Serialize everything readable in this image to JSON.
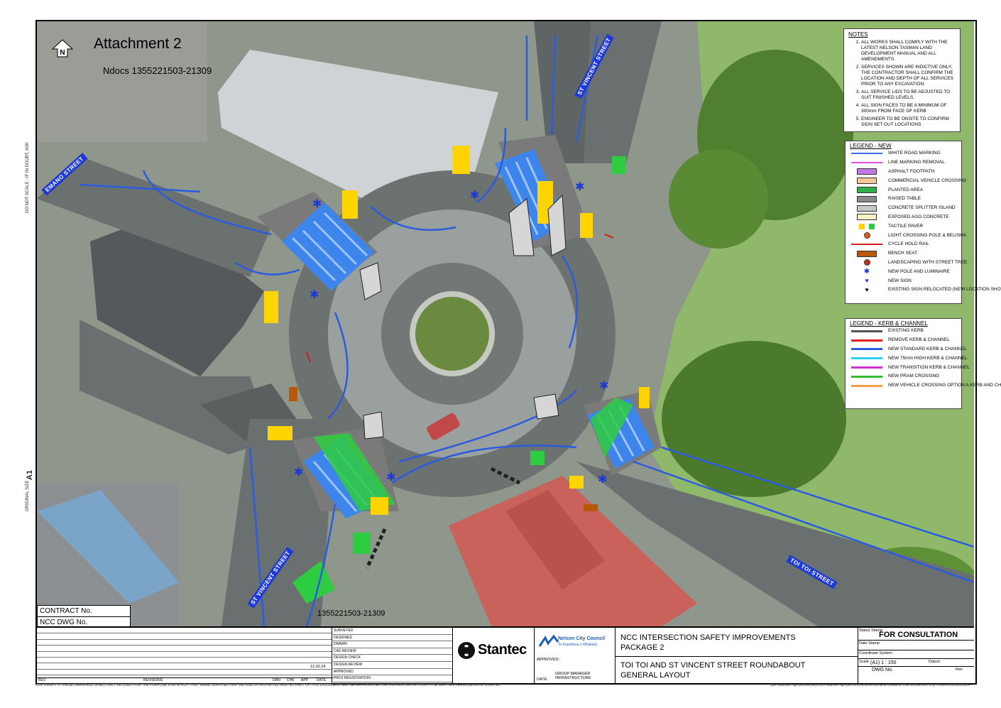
{
  "header": {
    "title": "Attachment 2",
    "ndocs": "Ndocs 1355221503-21309",
    "ndocs_bottom": "1355221503-21309"
  },
  "streets": {
    "st_vincent_top": "ST VINCENT STREET",
    "emano": "EMANO STREET",
    "st_vincent_bottom": "ST VINCENT STREET",
    "toi_toi": "TOI TOI STREET"
  },
  "north_arrow": "N",
  "notes": {
    "title": "NOTES",
    "items": [
      "ALL WORKS SHALL COMPLY WITH THE LATEST NELSON TASMAN LAND DEVELOPMENT MANUAL AND ALL AMENDMENTS.",
      "SERVICES SHOWN ARE INDICTIVE ONLY, THE CONTRACTOR SHALL CONFIRM THE LOCATION AND DEPTH OF ALL SERVICES PRIOR TO ANY EXCAVATION.",
      "ALL SERVICE LIDS TO BE ADJUSTED TO SUIT FINISHED LEVELS.",
      "ALL SIGN FACES TO BE A MINIMUM OF 300mm FROM FACE OF KERB",
      "ENGINEER TO BE ONSITE TO CONFIRM SIGN SET OUT LOCATIONS"
    ]
  },
  "legend_new": {
    "title": "LEGEND - NEW",
    "items": [
      {
        "label": "WHITE ROAD MARKING",
        "kind": "line",
        "color": "#3a6ee8"
      },
      {
        "label": "LINE MARKING REMOVAL",
        "kind": "line",
        "color": "#e04ee0"
      },
      {
        "label": "ASPHALT FOOTPATH",
        "kind": "box",
        "color": "#c27ae8"
      },
      {
        "label": "COMMERCIAL VEHICLE CROSSING",
        "kind": "box",
        "color": "#f6c898"
      },
      {
        "label": "PLANTED AREA",
        "kind": "box",
        "color": "#2fae4a"
      },
      {
        "label": "RAISED TABLE",
        "kind": "box",
        "color": "#8a8a8a"
      },
      {
        "label": "CONCRETE SPLITTER ISLAND",
        "kind": "box",
        "color": "#c8c8c8"
      },
      {
        "label": "EXPOSED AGG CONCRETE",
        "kind": "box",
        "color": "#fbf3c8"
      },
      {
        "label": "TACTILE PAVER",
        "kind": "pair",
        "color": "#ffd400",
        "color2": "#2ecc40"
      },
      {
        "label": "LIGHT CROSSING POLE & BELISHA",
        "kind": "dot",
        "color": "#e05a1a"
      },
      {
        "label": "CYCLE HOLD RAIL",
        "kind": "line",
        "color": "#d81818"
      },
      {
        "label": "BENCH SEAT",
        "kind": "box",
        "color": "#b8580c"
      },
      {
        "label": "LANDSCAPING WITH STREET TREE",
        "kind": "dot",
        "color": "#c03020"
      },
      {
        "label": "NEW POLE AND LUMINAIRE",
        "kind": "star",
        "color": "#1d39d8"
      },
      {
        "label": "NEW SIGN",
        "kind": "heart",
        "color": "#1d39d8"
      },
      {
        "label": "EXISTING SIGN RELOCATED (NEW LOCATION SHOWN)",
        "kind": "heart",
        "color": "#111111"
      }
    ]
  },
  "legend_kc": {
    "title": "LEGEND - KERB & CHANNEL",
    "items": [
      {
        "label": "EXISTING KERB",
        "color": "#555555"
      },
      {
        "label": "REMOVE KERB & CHANNEL",
        "color": "#e02020"
      },
      {
        "label": "NEW STANDARD KERB & CHANNEL",
        "color": "#2a5be0"
      },
      {
        "label": "NEW 75mm HIGH KERB & CHANNEL",
        "color": "#2ad0f0"
      },
      {
        "label": "NEW TRANSITION KERB & CHANNEL",
        "color": "#d030d0"
      },
      {
        "label": "NEW PRAM CROSSING",
        "color": "#30c030"
      },
      {
        "label": "NEW VEHICLE CROSSING OPTION A KERB AND CHANNEL",
        "color": "#f0a040"
      }
    ]
  },
  "margin": {
    "scale_note": "DO NOT SCALE - IF IN DOUBT, ASK",
    "original_size": "ORIGINAL SIZE",
    "size": "A1"
  },
  "contract": {
    "contract_no": "CONTRACT No.",
    "ncc_dwg_no": "NCC DWG No."
  },
  "title_block": {
    "rev": "REV",
    "revisions": "REVISIONS",
    "drn": "DRN",
    "chk": "CHK",
    "app": "APP",
    "date": "DATE",
    "sign_rows": [
      "SURVEYED",
      "DESIGNED",
      "DRAWN",
      "CAD REVIEW",
      "DESIGN CHECK",
      "DESIGN REVIEW",
      "APPROVED",
      "PROJ REGISTRATION"
    ],
    "design_date": "12.02.24",
    "stantec": "Stantec",
    "council_name": "Nelson City Council",
    "council_sub": "Te Kaunihera o Whakatū",
    "approved": "APPROVED:",
    "date_label": "DATE:",
    "gm": "GROUP MANAGER INFRASTRUCTURE",
    "project_line1": "NCC INTERSECTION SAFETY IMPROVEMENTS",
    "project_line2": "PACKAGE 2",
    "drawing_line1": "TOI TOI AND ST VINCENT STREET ROUNDABOUT",
    "drawing_line2": "GENERAL LAYOUT",
    "status_label": "Status Stamp",
    "status": "FOR CONSULTATION",
    "date_stamp": "Date Stamp",
    "coord_system": "Coordinate System",
    "scale_label": "Scale",
    "scale": "(A1) 1 : 150",
    "datum": "Datum",
    "dwg_no": "DWG No.",
    "rev_label": "Rev"
  },
  "footer": {
    "copyright": "COPYRIGHT ©   THESE DRAWINGS SHALL ONLY BE USED FOR THE PURPOSE FOR WHICH THEY WERE SUPPLIED. ANY RE-USE IS PROHIBITED AND NO PART OF THIS DOCUMENT MAY BE REPRODUCED OR DISTRIBUTED WITHOUT THE WRITTEN PERMISSION OF STANTEC",
    "path": "pw:\\\\stantec-ap-pw.bentley.com:stantec-ap-pw-01\\Documents\\New Zealand Clients\\Nelson City Council\\310205624 -"
  }
}
